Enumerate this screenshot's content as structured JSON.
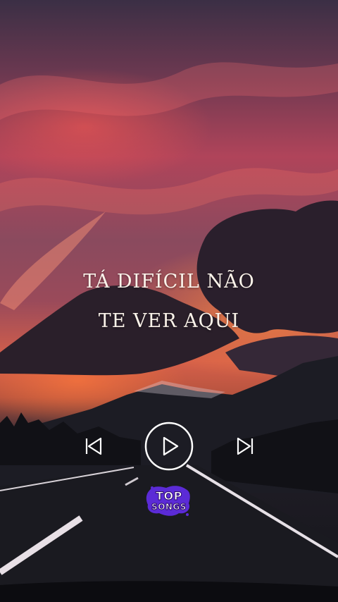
{
  "lyrics": {
    "line1": "TÁ DIFÍCIL NÃO",
    "line2": "TE VER AQUI"
  },
  "player": {
    "prev_icon": "skip-previous-icon",
    "play_icon": "play-icon",
    "next_icon": "skip-next-icon"
  },
  "badge": {
    "line1": "TOP",
    "line2": "SONGS",
    "color": "#5b2bd6"
  },
  "background": {
    "sky_colors": [
      "#3b2f45",
      "#b0445a",
      "#d6604a"
    ],
    "road_color": "#15151b"
  }
}
